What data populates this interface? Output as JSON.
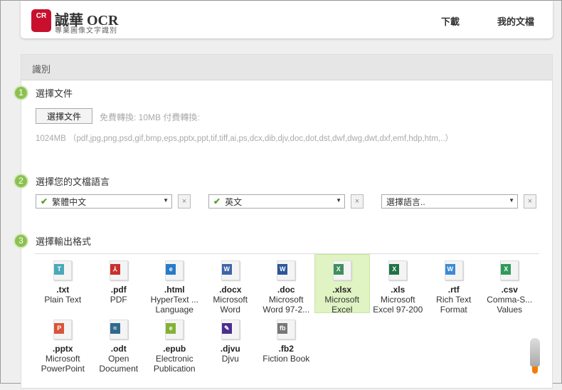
{
  "header": {
    "logo_text": "CR",
    "brand": "誠華 OCR",
    "tagline": "專業圖像文字識別",
    "nav": [
      {
        "label": "下載"
      },
      {
        "label": "我的文檔"
      }
    ]
  },
  "panel": {
    "title": "識別",
    "steps": [
      {
        "num": "1",
        "label": "選擇文件"
      },
      {
        "num": "2",
        "label": "選擇您的文檔語言"
      },
      {
        "num": "3",
        "label": "選擇輸出格式"
      }
    ],
    "file_button": "選擇文件",
    "limits": "免費轉換: 10MB  付費轉換:",
    "formats_note": "1024MB  （pdf,jpg,png,psd,gif,bmp,eps,pptx,ppt,tif,tiff,ai,ps,dcx,dib,djv,doc,dot,dst,dwf,dwg,dwt,dxf,emf,hdp,htm,..）",
    "languages": [
      {
        "value": "繁體中文",
        "checked": true
      },
      {
        "value": "英文",
        "checked": true
      },
      {
        "value": "選擇語言..",
        "checked": false
      }
    ],
    "clear_label": "×",
    "output_formats": [
      {
        "ext": ".txt",
        "desc": "Plain Text",
        "icon": "T",
        "color": "#4aa8b8"
      },
      {
        "ext": ".pdf",
        "desc": "PDF",
        "icon": "⅄",
        "color": "#c9302c"
      },
      {
        "ext": ".html",
        "desc": "HyperText ... Language",
        "icon": "e",
        "color": "#2a7ac8"
      },
      {
        "ext": ".docx",
        "desc": "Microsoft Word",
        "icon": "W",
        "color": "#3d64a8"
      },
      {
        "ext": ".doc",
        "desc": "Microsoft Word 97-2...",
        "icon": "W",
        "color": "#2b579a"
      },
      {
        "ext": ".xlsx",
        "desc": "Microsoft Excel",
        "icon": "X",
        "color": "#3f8f5c",
        "selected": true
      },
      {
        "ext": ".xls",
        "desc": "Microsoft Excel 97-200",
        "icon": "X",
        "color": "#217346"
      },
      {
        "ext": ".rtf",
        "desc": "Rich Text Format",
        "icon": "W",
        "color": "#3c8ad4"
      },
      {
        "ext": ".csv",
        "desc": "Comma-S... Values",
        "icon": "X",
        "color": "#2d9a5a"
      },
      {
        "ext": ".pptx",
        "desc": "Microsoft PowerPoint",
        "icon": "P",
        "color": "#d9543b"
      },
      {
        "ext": ".odt",
        "desc": "Open Document",
        "icon": "≈",
        "color": "#2f6a8e"
      },
      {
        "ext": ".epub",
        "desc": "Electronic Publication",
        "icon": "e",
        "color": "#84b135"
      },
      {
        "ext": ".djvu",
        "desc": "Djvu",
        "icon": "✎",
        "color": "#4b2d8f"
      },
      {
        "ext": ".fb2",
        "desc": "Fiction Book",
        "icon": "fb",
        "color": "#777"
      }
    ]
  },
  "colors": {
    "accent": "#8cc152",
    "selected_bg": "#dff3c3"
  }
}
